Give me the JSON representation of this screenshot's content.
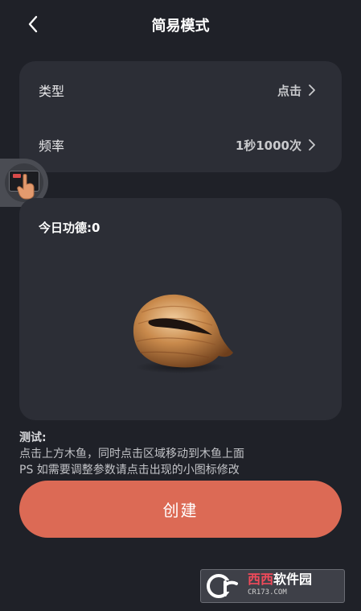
{
  "header": {
    "title": "简易模式"
  },
  "settings": {
    "type_label": "类型",
    "type_value": "点击",
    "freq_label": "频率",
    "freq_value": "1秒1000次"
  },
  "merit": {
    "text": "今日功德:0"
  },
  "test": {
    "title": "测试:",
    "line1": "点击上方木鱼，同时点击区域移动到木鱼上面",
    "line2": "PS 如需要调整参数请点击出现的小图标修改"
  },
  "create_button_label": "创建",
  "watermark": {
    "text_red": "西西",
    "text_white": "软件园",
    "url": "CR173.COM"
  },
  "colors": {
    "background": "#1f2128",
    "card": "#2c2e36",
    "accent": "#dc6a55"
  }
}
